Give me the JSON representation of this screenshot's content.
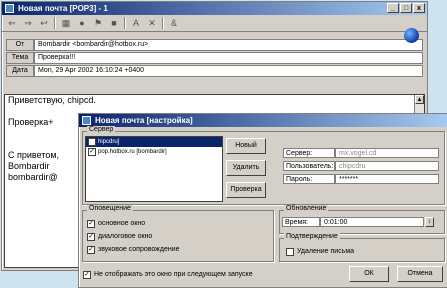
{
  "main_window": {
    "title": "Новая почта [POP3] - 1",
    "controls": [
      "_",
      "□",
      "x"
    ],
    "toolbar_icons": [
      "back-icon",
      "forward-icon",
      "reply-icon",
      "print-icon",
      "delete-icon",
      "flag-icon",
      "font-icon",
      "close-icon",
      "attach-icon"
    ],
    "from_label": "От",
    "from_value": "Bombardir <bombardir@hotbox.ru>",
    "subject_label": "Тема",
    "subject_value": "Проверка!!!",
    "date_label": "Дата",
    "date_value": "Mon, 29 Apr 2002 16:10:24 +0400",
    "body_lines": [
      "Приветствую, chipcd.",
      "",
      "Проверка+",
      "",
      "",
      "С приветом,",
      "Bombardir",
      "bombardir@"
    ]
  },
  "dialog": {
    "title": "Новая почта [настройка]",
    "server_group": "Сервер",
    "accounts": [
      {
        "name": "hipcdru]",
        "checked": true,
        "selected": true
      },
      {
        "name": "pop.hotbox.ru [bombardir]",
        "checked": true,
        "selected": false
      }
    ],
    "new_btn": "Новый",
    "delete_btn": "Удалить",
    "check_btn": "Проверка",
    "server_label": "Сервер:",
    "server_value": "mx.vogel.cd",
    "user_label": "Пользователь:",
    "user_value": "chipcdru",
    "pass_label": "Пароль:",
    "pass_value": "*******",
    "notify_group": "Оповещение",
    "notify_items": [
      {
        "label": "основное окно",
        "checked": true
      },
      {
        "label": "диалоговое окно",
        "checked": true
      },
      {
        "label": "звуковое сопровождение",
        "checked": true
      }
    ],
    "update_group": "Обновление",
    "time_label": "Время:",
    "time_value": "0:01:00",
    "confirm_group": "Подтверждение",
    "delete_msg_label": "Удаление письма",
    "dont_show_label": "Не отображать это окно при следующем запуске",
    "ok_btn": "ОК",
    "cancel_btn": "Отмена"
  }
}
